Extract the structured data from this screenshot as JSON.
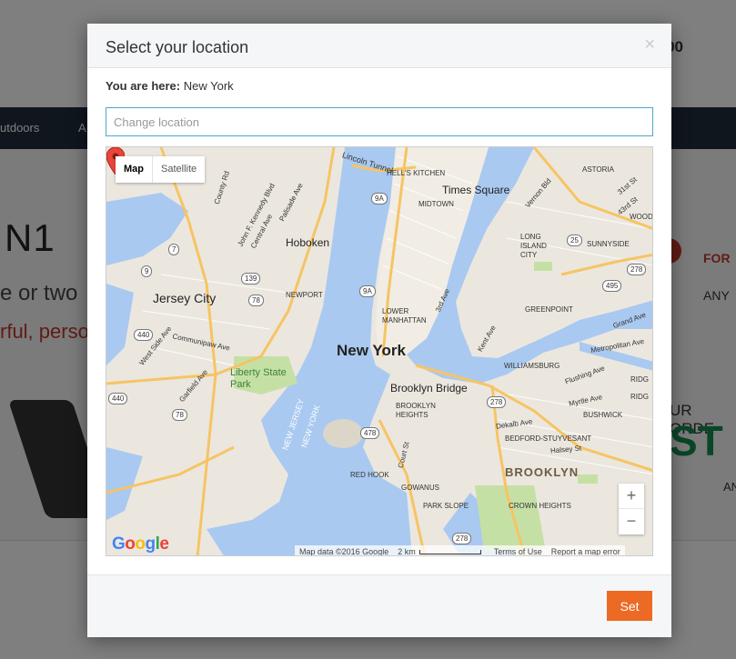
{
  "background": {
    "header_right": "00",
    "nav_items": [
      "utdoors",
      "A"
    ],
    "hero_big": "N1",
    "hero_line1": "e or two",
    "hero_line2": "rful, perso",
    "for_text": "FOR",
    "any_text": "ANY",
    "order_text": "UR ORDE",
    "sto_text": "ST",
    "an_text": "AN"
  },
  "modal": {
    "title": "Select your location",
    "close_glyph": "×",
    "here_label": "You are here:",
    "here_value": "New York",
    "input_placeholder": "Change location",
    "input_value": "",
    "set_label": "Set"
  },
  "map": {
    "type_buttons": [
      "Map",
      "Satellite"
    ],
    "active_type": "Map",
    "zoom_in": "+",
    "zoom_out": "−",
    "logo": "Google",
    "attribution": {
      "map_data": "Map data ©2016 Google",
      "scale": "2 km",
      "terms": "Terms of Use",
      "report": "Report a map error"
    },
    "labels": {
      "new_york": "New York",
      "jersey_city": "Jersey City",
      "hoboken": "Hoboken",
      "times_square": "Times Square",
      "brooklyn_bridge": "Brooklyn Bridge",
      "brooklyn": "BROOKLYN",
      "liberty_state_park": "Liberty State Park",
      "newport": "NEWPORT",
      "lower_manhattan": "LOWER MANHATTAN",
      "midtown": "MIDTOWN",
      "hells_kitchen": "HELL'S KITCHEN",
      "lincoln_tunnel": "Lincoln Tunnel",
      "astoria": "ASTORIA",
      "long_island_city": "LONG ISLAND CITY",
      "sunnyside": "SUNNYSIDE",
      "greenpoint": "GREENPOINT",
      "williamsburg": "WILLIAMSBURG",
      "brooklyn_heights": "BROOKLYN HEIGHTS",
      "bushwick": "BUSHWICK",
      "bedford_stuyvesant": "BEDFORD-STUYVESANT",
      "red_hook": "RED HOOK",
      "gowanus": "GOWANUS",
      "park_slope": "PARK SLOPE",
      "crown_heights": "CROWN HEIGHTS",
      "metropolitan_ave": "Metropolitan Ave",
      "flushing_ave": "Flushing Ave",
      "myrtle_ave": "Myrtle Ave",
      "dekalb_ave": "Dekalb Ave",
      "halsey_st": "Halsey St",
      "grand_ave": "Grand Ave",
      "kent_ave": "Kent Ave",
      "new_jersey": "NEW JERSEY",
      "new_york_water": "NEW YORK",
      "john_f_kennedy_blvd": "John F. Kennedy Blvd",
      "central_ave": "Central Ave",
      "palisade_ave": "Palisade Ave",
      "county_rd": "County Rd",
      "communipaw_ave": "Communipaw Ave",
      "west_side_ave": "West Side Ave",
      "garfield_ave": "Garfield Ave",
      "court_st": "Court St",
      "third_ave": "3rd Ave",
      "vernon_blvd": "Vernon Bld",
      "wood": "WOOD",
      "ridg": "RIDG",
      "ridg2": "RIDG",
      "st_31": "31st St",
      "st_43": "43rd St"
    },
    "shields": [
      "9A",
      "9A",
      "7",
      "9",
      "139",
      "78",
      "440",
      "440",
      "78",
      "25",
      "278",
      "495",
      "278",
      "478",
      "278",
      "278"
    ]
  },
  "colors": {
    "water": "#a9c9f0",
    "land": "#ebe7df",
    "park": "#c5e0a5",
    "road_major": "#f7c463",
    "road_minor": "#ffffff",
    "set_button": "#ec6a24",
    "input_border": "#4fa7c9",
    "pin": "#e8453c"
  }
}
